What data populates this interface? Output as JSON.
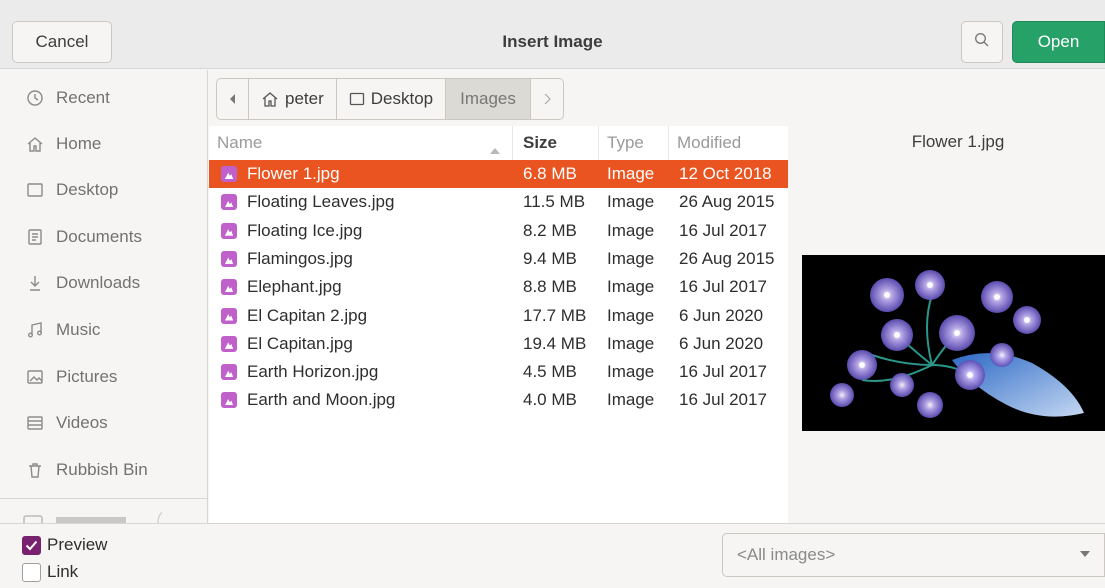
{
  "dialog": {
    "title": "Insert Image",
    "cancel_label": "Cancel",
    "open_label": "Open",
    "accent": "#26a269"
  },
  "sidebar": {
    "items": [
      {
        "label": "Recent",
        "icon": "clock-icon"
      },
      {
        "label": "Home",
        "icon": "home-icon"
      },
      {
        "label": "Desktop",
        "icon": "desktop-icon"
      },
      {
        "label": "Documents",
        "icon": "document-icon"
      },
      {
        "label": "Downloads",
        "icon": "download-icon"
      },
      {
        "label": "Music",
        "icon": "music-icon"
      },
      {
        "label": "Pictures",
        "icon": "picture-icon"
      },
      {
        "label": "Videos",
        "icon": "video-icon"
      },
      {
        "label": "Rubbish Bin",
        "icon": "trash-icon"
      }
    ]
  },
  "pathbar": {
    "crumbs": [
      "peter",
      "Desktop",
      "Images"
    ]
  },
  "filelist": {
    "columns": {
      "name": "Name",
      "size": "Size",
      "type": "Type",
      "modified": "Modified"
    },
    "selected_color": "#e95420",
    "rows": [
      {
        "name": "Flower 1.jpg",
        "size": "6.8 MB",
        "type": "Image",
        "modified": "12 Oct 2018"
      },
      {
        "name": "Floating Leaves.jpg",
        "size": "11.5 MB",
        "type": "Image",
        "modified": "26 Aug 2015"
      },
      {
        "name": "Floating Ice.jpg",
        "size": "8.2 MB",
        "type": "Image",
        "modified": "16 Jul 2017"
      },
      {
        "name": "Flamingos.jpg",
        "size": "9.4 MB",
        "type": "Image",
        "modified": "26 Aug 2015"
      },
      {
        "name": "Elephant.jpg",
        "size": "8.8 MB",
        "type": "Image",
        "modified": "16 Jul 2017"
      },
      {
        "name": "El Capitan 2.jpg",
        "size": "17.7 MB",
        "type": "Image",
        "modified": "6 Jun 2020"
      },
      {
        "name": "El Capitan.jpg",
        "size": "19.4 MB",
        "type": "Image",
        "modified": "6 Jun 2020"
      },
      {
        "name": "Earth Horizon.jpg",
        "size": "4.5 MB",
        "type": "Image",
        "modified": "16 Jul 2017"
      },
      {
        "name": "Earth and Moon.jpg",
        "size": "4.0 MB",
        "type": "Image",
        "modified": "16 Jul 2017"
      }
    ]
  },
  "preview": {
    "filename": "Flower 1.jpg"
  },
  "options": {
    "preview_label": "Preview",
    "preview_checked": true,
    "link_label": "Link",
    "link_checked": false,
    "filter_value": "<All images>"
  }
}
